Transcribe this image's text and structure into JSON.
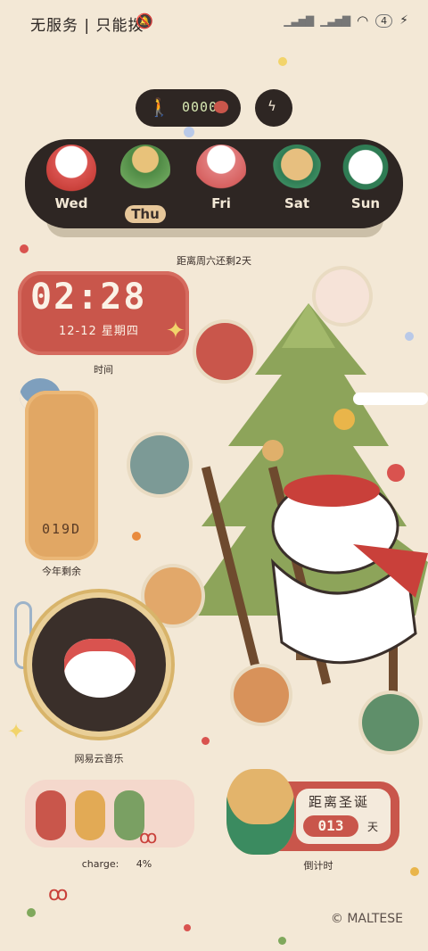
{
  "status_bar": {
    "carrier": "无服务 | 只能拨",
    "signal_note": "",
    "battery_level": "4"
  },
  "steps_widget": {
    "count": "0000"
  },
  "week": {
    "days": [
      {
        "label": "Wed",
        "active": false
      },
      {
        "label": "Thu",
        "active": true
      },
      {
        "label": "Fri",
        "active": false
      },
      {
        "label": "Sat",
        "active": false
      },
      {
        "label": "Sun",
        "active": false
      }
    ],
    "caption": "距离周六还剩2天"
  },
  "clock_widget": {
    "time": "02:28",
    "date": "12-12  星期四",
    "caption": "时间"
  },
  "year_widget": {
    "days_left": "019D",
    "caption": "今年剩余"
  },
  "music_widget": {
    "caption": "网易云音乐"
  },
  "battery_widget": {
    "caption": "charge:",
    "value": "4%"
  },
  "christmas_widget": {
    "title": "距离圣诞",
    "days": "013",
    "unit": "天",
    "caption": "倒计时"
  },
  "copyright": "© MALTESE",
  "colors": {
    "background": "#f3e8d6",
    "dark": "#2e2623",
    "red": "#c9564b",
    "accent": "#e7c79a"
  }
}
